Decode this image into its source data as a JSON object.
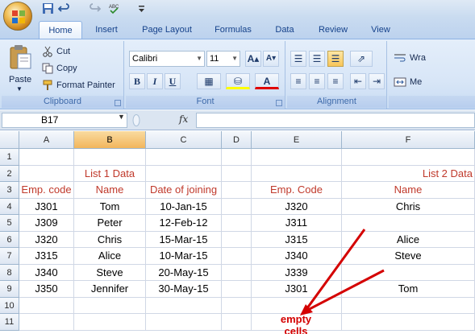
{
  "ribbon": {
    "tabs": [
      "Home",
      "Insert",
      "Page Layout",
      "Formulas",
      "Data",
      "Review",
      "View"
    ],
    "active_tab": "Home",
    "clipboard": {
      "paste": "Paste",
      "cut": "Cut",
      "copy": "Copy",
      "format_painter": "Format Painter",
      "label": "Clipboard"
    },
    "font": {
      "family": "Calibri",
      "size": "11",
      "bold": "B",
      "italic": "I",
      "underline": "U",
      "label": "Font"
    },
    "alignment": {
      "wrap": "Wra",
      "merge": "Me",
      "label": "Alignment"
    }
  },
  "formula_bar": {
    "name_box": "B17",
    "fx": "fx",
    "value": ""
  },
  "sheet": {
    "columns": [
      "A",
      "B",
      "C",
      "D",
      "E",
      "F"
    ],
    "selected_column": "B",
    "rows": [
      "1",
      "2",
      "3",
      "4",
      "5",
      "6",
      "7",
      "8",
      "9",
      "10",
      "11"
    ],
    "cells": {
      "B2": "List 1 Data",
      "F2": "List 2 Data",
      "A3": "Emp. code",
      "B3": "Name",
      "C3": "Date of joining",
      "E3": "Emp. Code",
      "F3": "Name",
      "A4": "J301",
      "B4": "Tom",
      "C4": "10-Jan-15",
      "E4": "J320",
      "F4": "Chris",
      "A5": "J309",
      "B5": "Peter",
      "C5": "12-Feb-12",
      "E5": "J311",
      "F5": "",
      "A6": "J320",
      "B6": "Chris",
      "C6": "15-Mar-15",
      "E6": "J315",
      "F6": "Alice",
      "A7": "J315",
      "B7": "Alice",
      "C7": "10-Mar-15",
      "E7": "J340",
      "F7": "Steve",
      "A8": "J340",
      "B8": "Steve",
      "C8": "20-May-15",
      "E8": "J339",
      "F8": "",
      "A9": "J350",
      "B9": "Jennifer",
      "C9": "30-May-15",
      "E9": "J301",
      "F9": "Tom"
    },
    "annotation": "empty cells",
    "colors": {
      "header_text": "#c0392b",
      "annotation": "#d40000",
      "selected_header": "#f2b65c"
    }
  }
}
